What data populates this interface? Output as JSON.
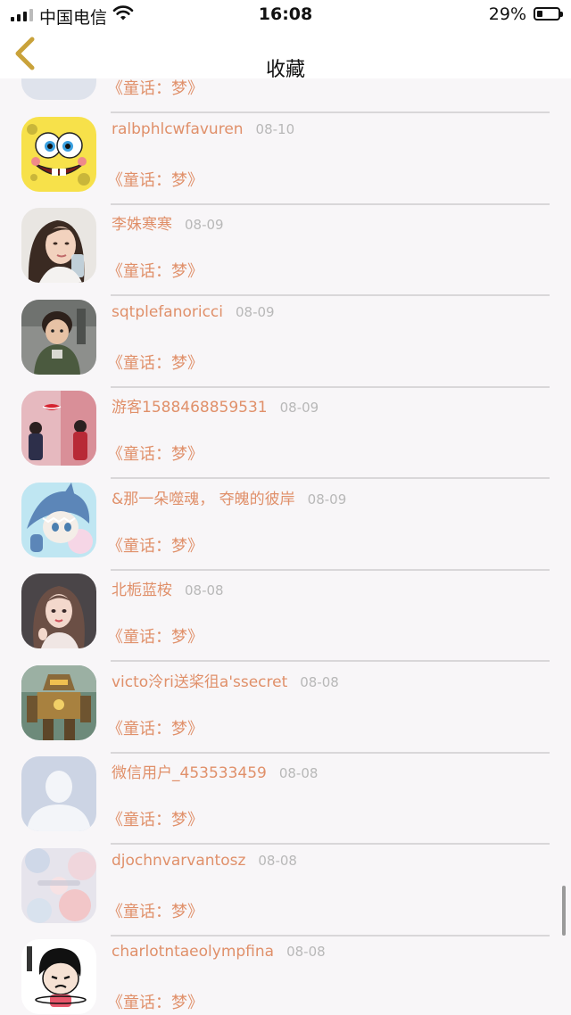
{
  "status_bar": {
    "carrier": "中国电信",
    "time": "16:08",
    "battery_percent_text": "29%",
    "battery_level": 0.29
  },
  "nav": {
    "back_icon": "chevron-left-icon",
    "back_color": "#c9a23a",
    "title": "收藏"
  },
  "colors": {
    "accent": "#e0906a",
    "date": "#b8b8b8",
    "divider": "#d9d7d9",
    "background": "#f8f6f8"
  },
  "items": [
    {
      "name": "",
      "date": "",
      "work": "《童话：梦》",
      "avatar": "partial-avatar"
    },
    {
      "name": "ralbphlcwfavuren",
      "date": "08-10",
      "work": "《童话：梦》",
      "avatar": "spongebob-avatar"
    },
    {
      "name": "李姝寒寒",
      "date": "08-09",
      "work": "《童话：梦》",
      "avatar": "woman-photo-avatar"
    },
    {
      "name": "sqtplefanoricci",
      "date": "08-09",
      "work": "《童话：梦》",
      "avatar": "child-photo-avatar"
    },
    {
      "name": "游客1588468859531",
      "date": "08-09",
      "work": "《童话：梦》",
      "avatar": "couple-photo-avatar"
    },
    {
      "name": "&那一朵噬魂， 夺魄的彼岸",
      "date": "08-09",
      "work": "《童话：梦》",
      "avatar": "anime-shark-avatar"
    },
    {
      "name": "北栀蓝桉",
      "date": "08-08",
      "work": "《童话：梦》",
      "avatar": "illustrated-girl-avatar"
    },
    {
      "name": "victo泠ri送桨徂a'ssecret",
      "date": "08-08",
      "work": "《童话：梦》",
      "avatar": "robot-avatar"
    },
    {
      "name": "微信用户_453533459",
      "date": "08-08",
      "work": "《童话：梦》",
      "avatar": "default-user-avatar"
    },
    {
      "name": "djochnvarvantosz",
      "date": "08-08",
      "work": "《童话：梦》",
      "avatar": "blurred-flower-avatar"
    },
    {
      "name": "charlotntaeolympfina",
      "date": "08-08",
      "work": "《童话：梦》",
      "avatar": "cartoon-girl-avatar"
    }
  ]
}
